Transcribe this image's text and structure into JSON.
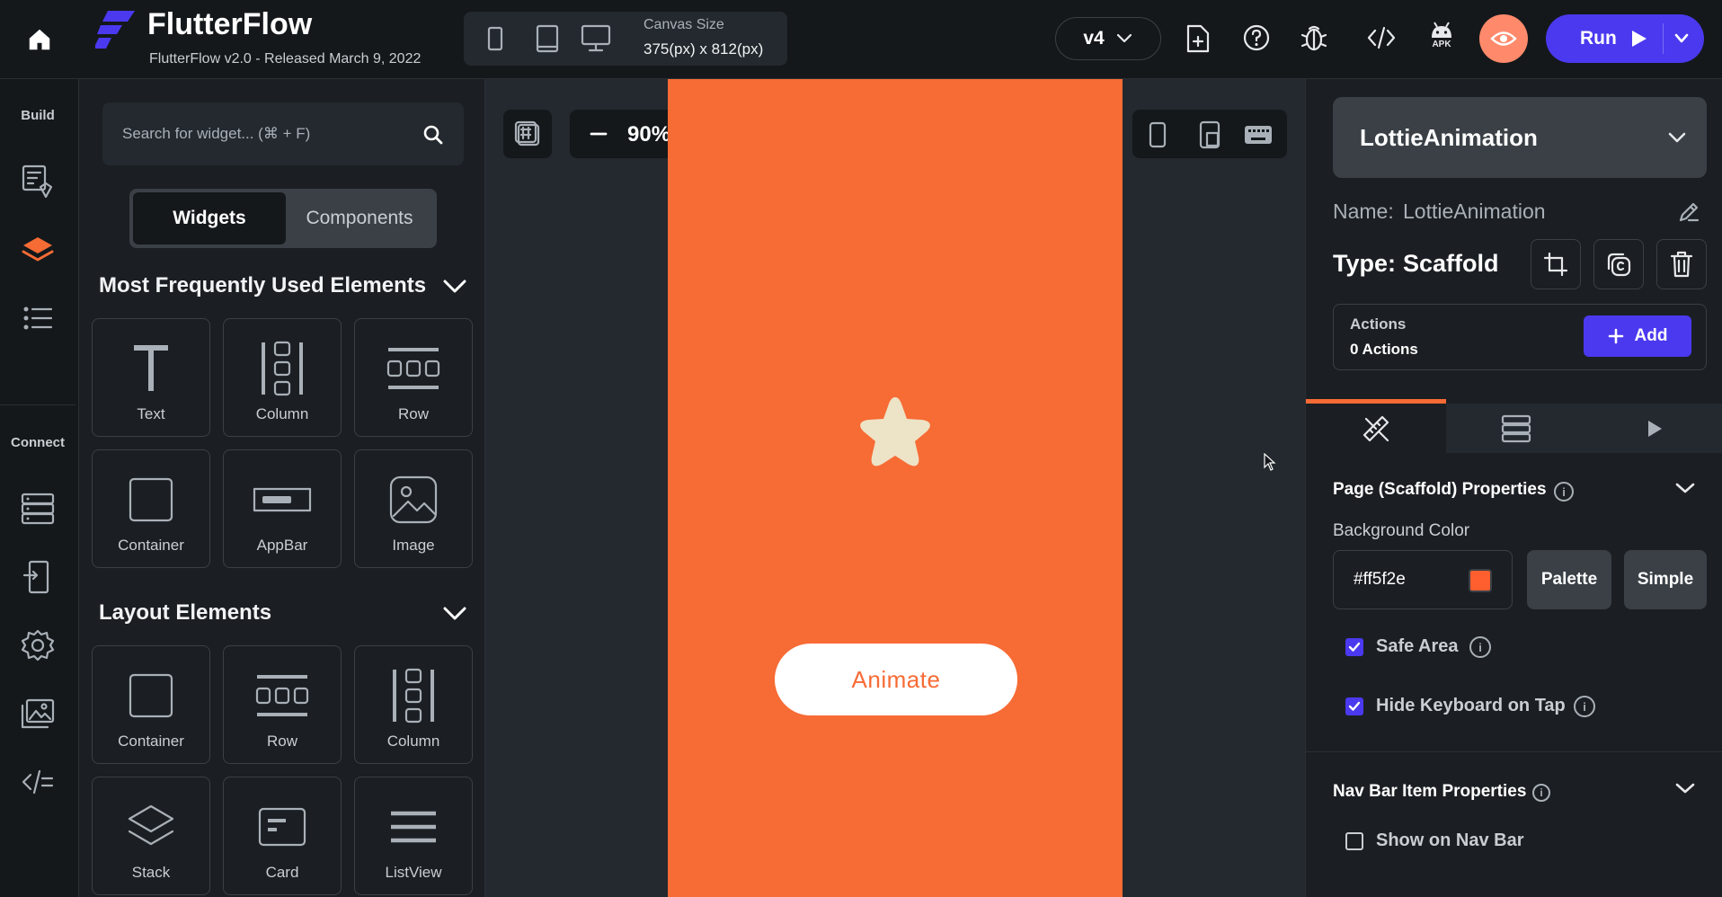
{
  "app": {
    "name": "FlutterFlow",
    "version_line": "FlutterFlow v2.0 - Released March 9, 2022"
  },
  "topbar": {
    "canvas_size_label": "Canvas Size",
    "canvas_size_value": "375(px) x 812(px)",
    "version_selector": "v4",
    "run_label": "Run",
    "apk_label": "APK"
  },
  "rail": {
    "build_label": "Build",
    "connect_label": "Connect"
  },
  "widget_panel": {
    "search_placeholder": "Search for widget... (⌘ + F)",
    "tabs": {
      "widgets": "Widgets",
      "components": "Components"
    },
    "sections": [
      {
        "title": "Most Frequently Used Elements",
        "items": [
          "Text",
          "Column",
          "Row",
          "Container",
          "AppBar",
          "Image"
        ]
      },
      {
        "title": "Layout Elements",
        "items": [
          "Container",
          "Row",
          "Column",
          "Stack",
          "Card",
          "ListView"
        ]
      }
    ]
  },
  "canvas": {
    "zoom": "90%",
    "page_background": "#f76b35",
    "button_label": "Animate",
    "star_color": "#ede3c6"
  },
  "props": {
    "widget_selector": "LottieAnimation",
    "name_label": "Name:",
    "name_value": "LottieAnimation",
    "type_label": "Type:",
    "type_value": "Scaffold",
    "actions_title": "Actions",
    "actions_count": "0 Actions",
    "add_label": "Add",
    "page_props_title": "Page (Scaffold) Properties",
    "bg_color_label": "Background Color",
    "bg_color_value": "#ff5f2e",
    "palette_label": "Palette",
    "simple_label": "Simple",
    "safe_area_label": "Safe Area",
    "hide_keyboard_label": "Hide Keyboard on Tap",
    "nav_bar_title": "Nav Bar Item Properties",
    "show_nav_label": "Show on Nav Bar"
  },
  "colors": {
    "accent": "#4b39ef",
    "canvas_orange": "#f76b35",
    "swatch": "#ff5f2e",
    "preview_button": "#ff8a6b"
  }
}
